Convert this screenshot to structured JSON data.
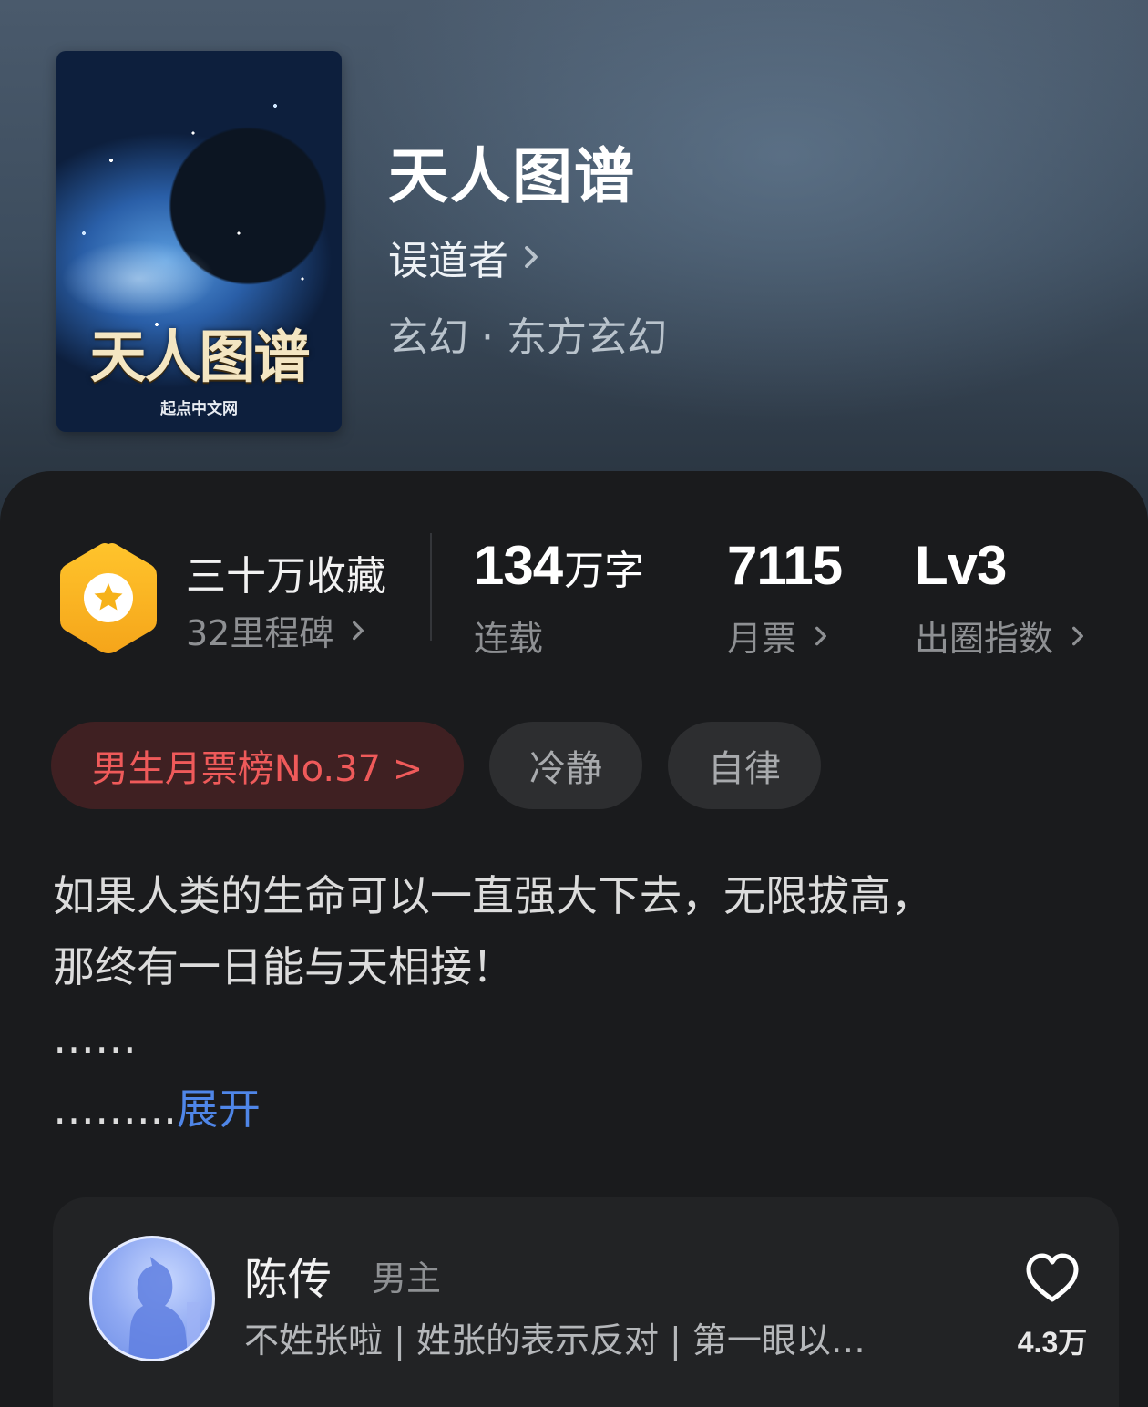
{
  "book": {
    "title": "天人图谱",
    "author": "误道者",
    "genre": "玄幻 · 东方玄幻",
    "cover": {
      "title": "天人图谱",
      "brand": "起点中文网"
    }
  },
  "stats": {
    "collection": {
      "label": "三十万收藏",
      "sub": "32里程碑"
    },
    "words": {
      "value": "134",
      "unit": "万字",
      "label": "连载"
    },
    "monthly_tickets": {
      "value": "7115",
      "label": "月票"
    },
    "influence": {
      "value": "Lv3",
      "label": "出圈指数"
    }
  },
  "tags": {
    "rank": "男生月票榜No.37 >",
    "items": [
      "冷静",
      "自律"
    ]
  },
  "description": {
    "line1": "如果人类的生命可以一直强大下去，无限拔高，",
    "line2": "那终有一日能与天相接！",
    "line3": "……",
    "line4_prefix": "……...",
    "expand_label": "展开"
  },
  "character": {
    "name": "陈传",
    "role": "男主",
    "desc": "不姓张啦 | 姓张的表示反对 | 第一眼以…",
    "likes": "4.3万"
  },
  "colors": {
    "accent_blue": "#4f86e8",
    "rank_red": "#ef5a5a",
    "badge_gold": "#f6b21a"
  },
  "icons": {
    "badge": "star-hexagon-icon",
    "chevron": "chevron-right-icon",
    "heart": "heart-outline-icon"
  }
}
